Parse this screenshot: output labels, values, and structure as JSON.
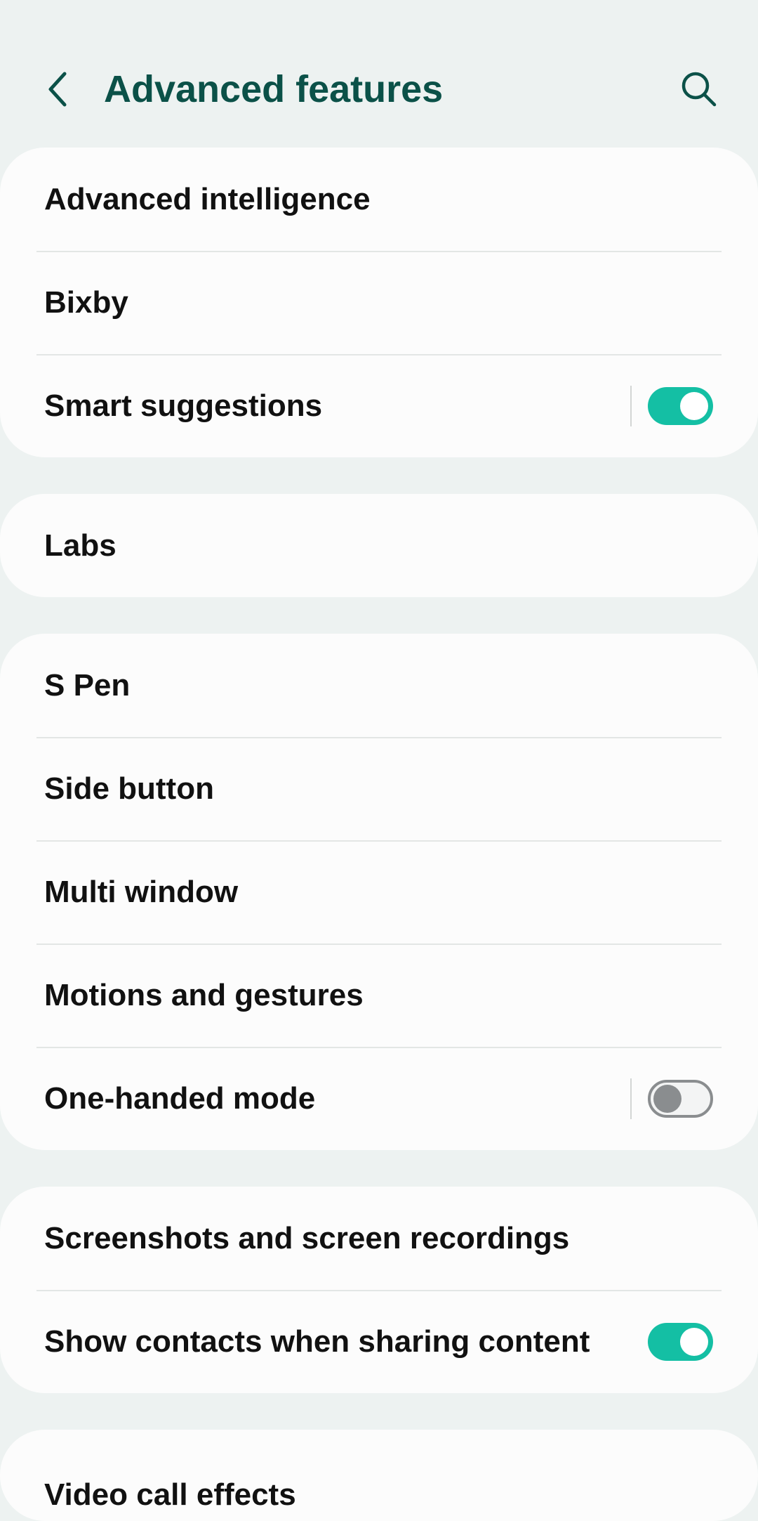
{
  "header": {
    "title": "Advanced features",
    "back_icon": "chevron-left-icon",
    "search_icon": "search-icon"
  },
  "colors": {
    "background": "#edf2f1",
    "card": "#fcfcfc",
    "title": "#0b5148",
    "switch_on": "#14bfa4",
    "switch_off": "#8a8d8f"
  },
  "groups": [
    {
      "items": [
        {
          "label": "Advanced intelligence"
        },
        {
          "label": "Bixby"
        },
        {
          "label": "Smart suggestions",
          "switch": "on",
          "divider": true
        }
      ]
    },
    {
      "items": [
        {
          "label": "Labs"
        }
      ]
    },
    {
      "items": [
        {
          "label": "S Pen"
        },
        {
          "label": "Side button"
        },
        {
          "label": "Multi window"
        },
        {
          "label": "Motions and gestures"
        },
        {
          "label": "One-handed mode",
          "switch": "off",
          "divider": true
        }
      ]
    },
    {
      "items": [
        {
          "label": "Screenshots and screen recordings"
        },
        {
          "label": "Show contacts when sharing content",
          "switch": "on"
        }
      ]
    },
    {
      "items": [
        {
          "label": "Video call effects"
        }
      ]
    }
  ]
}
